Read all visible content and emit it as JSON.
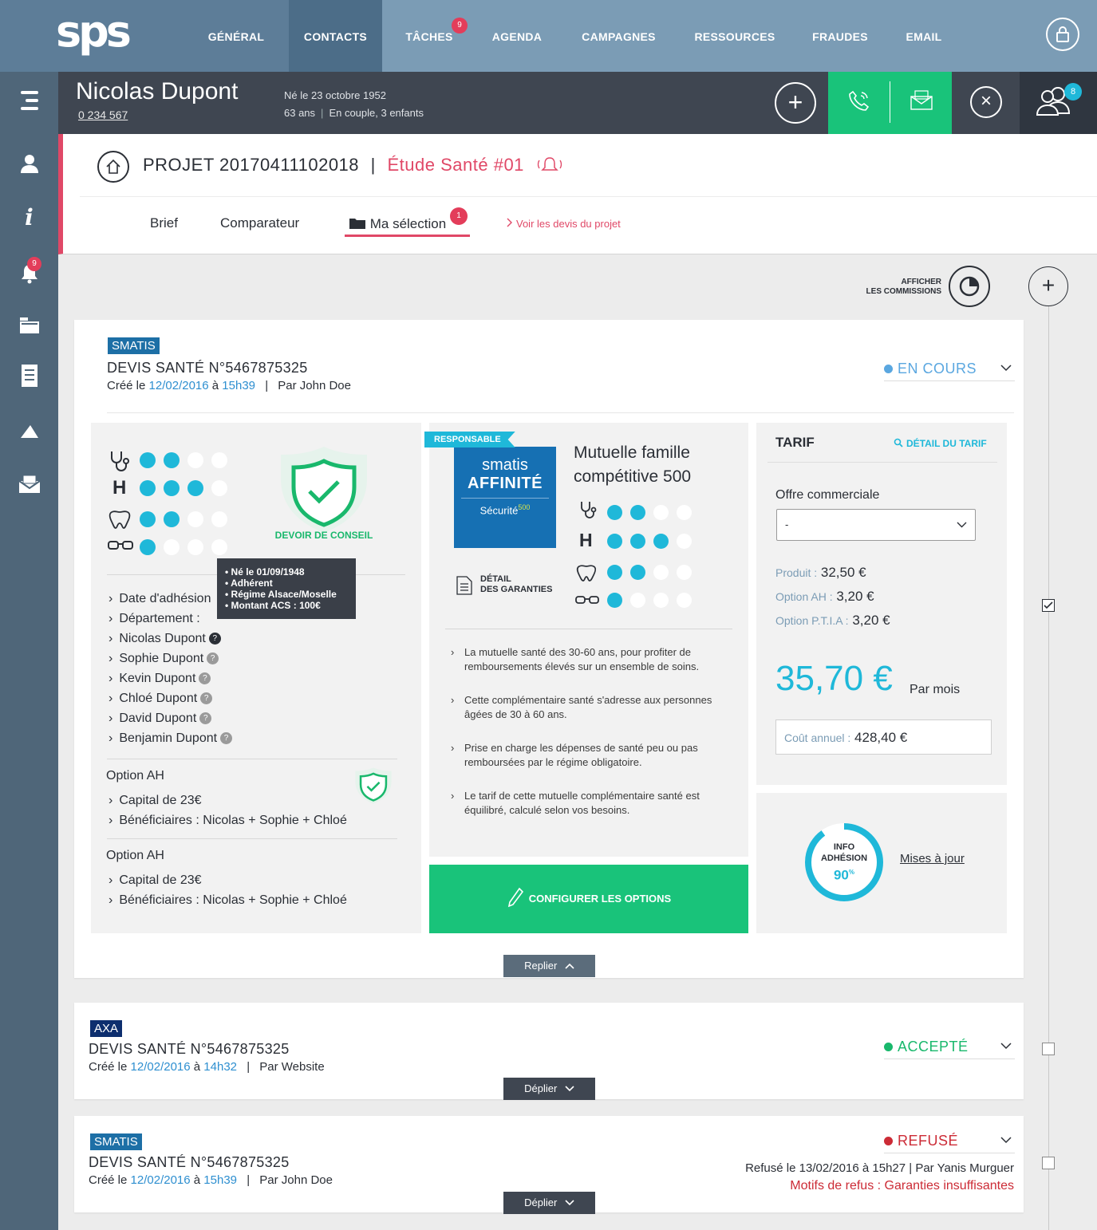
{
  "nav": {
    "logo": "sps",
    "items": [
      "GÉNÉRAL",
      "CONTACTS",
      "TÂCHES",
      "AGENDA",
      "CAMPAGNES",
      "RESSOURCES",
      "FRAUDES",
      "EMAIL"
    ],
    "taches_badge": "9"
  },
  "sidebar": {
    "notif_badge": "9"
  },
  "person": {
    "name": "Nicolas Dupont",
    "number": "0  234 567",
    "birth": "Né le 23 octobre 1952",
    "age": "63 ans",
    "family": "En couple, 3 enfants",
    "team_badge": "8"
  },
  "project": {
    "title": "PROJET 20170411102018",
    "separator": "|",
    "study": "Étude Santé #01",
    "tabs": [
      "Brief",
      "Comparateur",
      "Ma sélection"
    ],
    "selection_badge": "1",
    "devis_link": "Voir les devis du projet"
  },
  "commissions": {
    "line1": "AFFICHER",
    "line2": "LES COMMISSIONS"
  },
  "quote1": {
    "insurer": "SMATIS",
    "title": "DEVIS SANTÉ N°5467875325",
    "created_prefix": "Créé le",
    "date": "12/02/2016",
    "at": "à",
    "time": "15h39",
    "by": "Par John Doe",
    "status": "EN COURS",
    "status_color": "#5aa7e0",
    "devoir": "DEVOIR DE CONSEIL",
    "tooltip": [
      "• Né le 01/09/1948",
      "• Adhérent",
      "• Régime Alsace/Moselle",
      "• Montant ACS : 100€"
    ],
    "rows": [
      "Date d'adhésion",
      "Département :",
      "Nicolas Dupont",
      "Sophie Dupont",
      "Kevin Dupont",
      "Chloé Dupont",
      "David Dupont",
      "Benjamin Dupont"
    ],
    "options": [
      {
        "title": "Option AH",
        "capital": "Capital de 23€",
        "benef_label": "Bénéficiaires :",
        "benef": "Nicolas + Sophie + Chloé"
      },
      {
        "title": "Option AH",
        "capital": "Capital de 23€",
        "benef_label": "Bénéficiaires :",
        "benef": "Nicolas + Sophie + Chloé"
      }
    ],
    "product": {
      "ribbon": "RESPONSABLE",
      "logo_line1": "smatis",
      "logo_line2": "AFFINITÉ",
      "logo_line3": "Sécurité",
      "logo_sup": "500",
      "name": "Mutuelle famille compétitive 500",
      "detail_line1": "DÉTAIL",
      "detail_line2": "DES GARANTIES",
      "features": [
        "La mutuelle santé des 30-60 ans, pour profiter de remboursements élevés sur un ensemble de soins.",
        "Cette complémentaire santé s'adresse aux personnes âgées de 30 à 60 ans.",
        "Prise en charge les dépenses de santé peu ou pas remboursées par le régime obligatoire.",
        "Le tarif de cette mutuelle complémentaire santé est équilibré, calculé selon vos besoins."
      ],
      "configure": "CONFIGURER LES OPTIONS"
    },
    "tarif": {
      "title": "TARIF",
      "detail": "DÉTAIL DU TARIF",
      "offre_label": "Offre commerciale",
      "offre_value": "-",
      "lines": [
        {
          "label": "Produit :",
          "value": "32,50 €"
        },
        {
          "label": "Option AH :",
          "value": "3,20 €"
        },
        {
          "label": "Option P.T.I.A :",
          "value": "3,20 €"
        }
      ],
      "total": "35,70 €",
      "per": "Par mois",
      "annual_label": "Coût annuel :",
      "annual_value": "428,40 €"
    },
    "info": {
      "line1": "INFO",
      "line2": "ADHÉSION",
      "pct": "90",
      "pct_unit": "%",
      "progress": 0.9,
      "link": "Mises à jour"
    },
    "fold": "Replier"
  },
  "quote2": {
    "insurer": "AXA",
    "title": "DEVIS SANTÉ N°5467875325",
    "created_prefix": "Créé le",
    "date": "12/02/2016",
    "at": "à",
    "time": "14h32",
    "by": "Par Website",
    "status": "ACCEPTÉ",
    "status_color": "#19b86c",
    "unfold": "Déplier"
  },
  "quote3": {
    "insurer": "SMATIS",
    "title": "DEVIS SANTÉ N°5467875325",
    "created_prefix": "Créé le",
    "date": "12/02/2016",
    "at": "à",
    "time": "15h39",
    "by": "Par John Doe",
    "status": "REFUSÉ",
    "status_color": "#cc2b36",
    "refused_info": "Refusé le 13/02/2016 à 15h27 | Par Yanis Murguer",
    "motif": "Motifs de refus : Garanties insuffisantes",
    "unfold": "Déplier"
  }
}
